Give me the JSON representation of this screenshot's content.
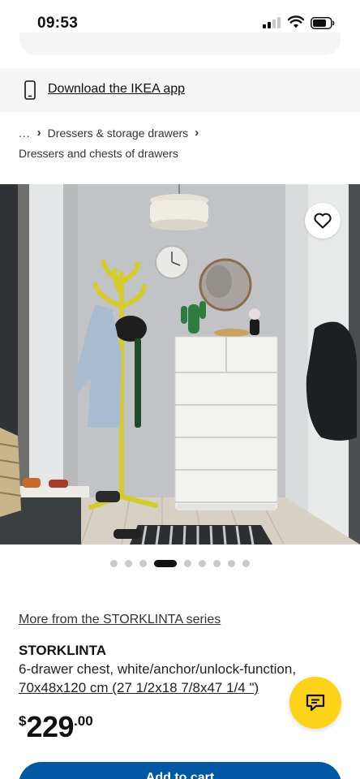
{
  "status_bar": {
    "time": "09:53",
    "icons": [
      "cellular-signal-icon",
      "wifi-icon",
      "battery-icon"
    ]
  },
  "app_banner": {
    "icon": "phone-icon",
    "link_text": "Download the IKEA app"
  },
  "breadcrumb": {
    "ellipsis": "...",
    "separator": "›",
    "items": [
      "Dressers & storage drawers"
    ],
    "current": "Dressers and chests of drawers"
  },
  "product_image": {
    "description": "IKEA STORKLINTA 6-drawer chest in a hallway",
    "wishlist_icon": "heart-icon"
  },
  "carousel": {
    "total": 9,
    "active_index": 3
  },
  "product": {
    "series_link": "More from the STORKLINTA series",
    "name": "STORKLINTA",
    "description": "6-drawer chest, white/anchor/unlock-function,",
    "dimensions": "70x48x120 cm (27 1/2x18 7/8x47 1/4 \")",
    "price": {
      "currency": "$",
      "integer": "229",
      "decimal": ".00"
    }
  },
  "chat": {
    "icon": "chat-icon"
  },
  "cart": {
    "label": "Add to cart"
  },
  "colors": {
    "brand_blue": "#0058a3",
    "brand_yellow": "#fdd31a",
    "banner_bg": "#f5f5f5"
  }
}
